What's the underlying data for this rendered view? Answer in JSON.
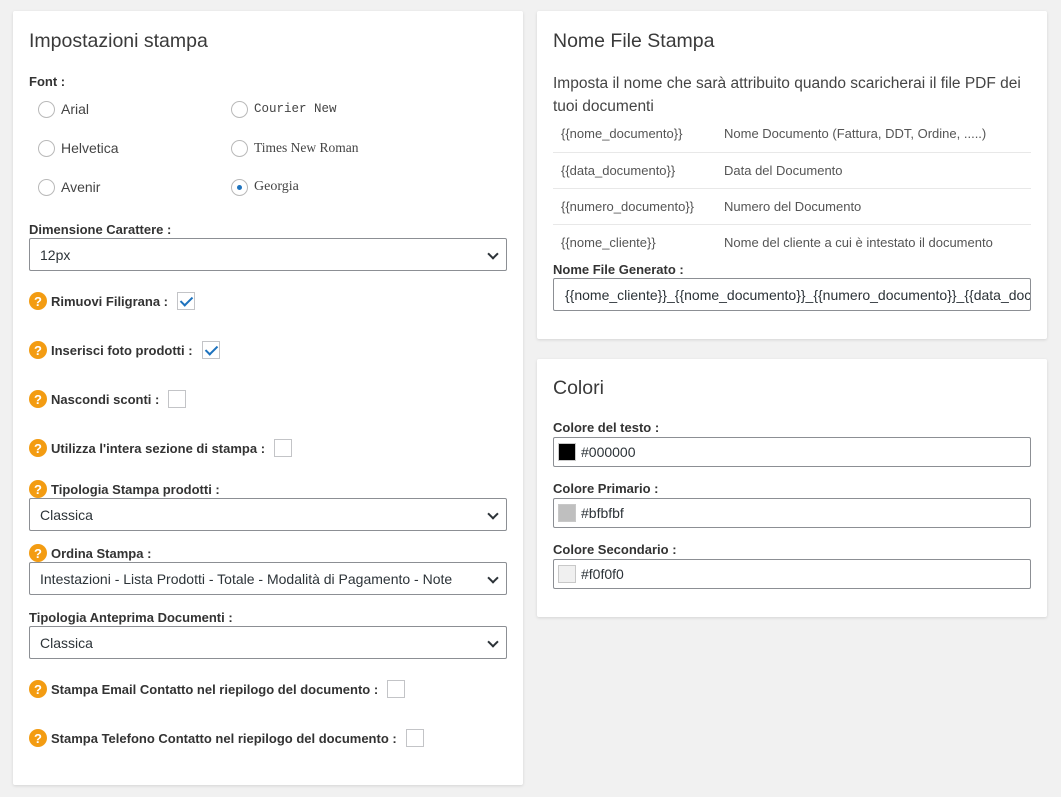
{
  "print_settings": {
    "title": "Impostazioni stampa",
    "font_label": "Font :",
    "fonts": [
      {
        "label": "Arial",
        "checked": false
      },
      {
        "label": "Courier New",
        "checked": false
      },
      {
        "label": "Helvetica",
        "checked": false
      },
      {
        "label": "Times New Roman",
        "checked": false
      },
      {
        "label": "Avenir",
        "checked": false
      },
      {
        "label": "Georgia",
        "checked": true
      }
    ],
    "font_size_label": "Dimensione Carattere :",
    "font_size_value": "12px",
    "remove_watermark_label": "Rimuovi Filigrana :",
    "remove_watermark_checked": true,
    "insert_photos_label": "Inserisci foto prodotti :",
    "insert_photos_checked": true,
    "hide_discounts_label": "Nascondi sconti :",
    "hide_discounts_checked": false,
    "full_print_area_label": "Utilizza l'intera sezione di stampa :",
    "full_print_area_checked": false,
    "product_print_type_label": "Tipologia Stampa prodotti :",
    "product_print_type_value": "Classica",
    "print_order_label": "Ordina Stampa :",
    "print_order_value": "Intestazioni - Lista Prodotti - Totale - Modalità di Pagamento - Note",
    "preview_type_label": "Tipologia Anteprima Documenti :",
    "preview_type_value": "Classica",
    "print_email_label": "Stampa Email Contatto nel riepilogo del documento :",
    "print_email_checked": false,
    "print_phone_label": "Stampa Telefono Contatto nel riepilogo del documento :",
    "print_phone_checked": false,
    "help_glyph": "?"
  },
  "file_name": {
    "title": "Nome File Stampa",
    "description": "Imposta il nome che sarà attribuito quando scaricherai il file PDF dei tuoi documenti",
    "placeholders": [
      {
        "key": "{{nome_documento}}",
        "desc": "Nome Documento (Fattura, DDT, Ordine, .....)"
      },
      {
        "key": "{{data_documento}}",
        "desc": "Data del Documento"
      },
      {
        "key": "{{numero_documento}}",
        "desc": "Numero del Documento"
      },
      {
        "key": "{{nome_cliente}}",
        "desc": "Nome del cliente a cui è intestato il documento"
      }
    ],
    "generated_label": "Nome File Generato :",
    "generated_value": "{{nome_cliente}}_{{nome_documento}}_{{numero_documento}}_{{data_documento}}"
  },
  "colors": {
    "title": "Colori",
    "text_color_label": "Colore del testo :",
    "text_color_value": "#000000",
    "primary_color_label": "Colore Primario :",
    "primary_color_value": "#bfbfbf",
    "secondary_color_label": "Colore Secondario :",
    "secondary_color_value": "#f0f0f0"
  },
  "accent_colors": {
    "help_icon": "#f39c12",
    "check": "#1e73be"
  }
}
